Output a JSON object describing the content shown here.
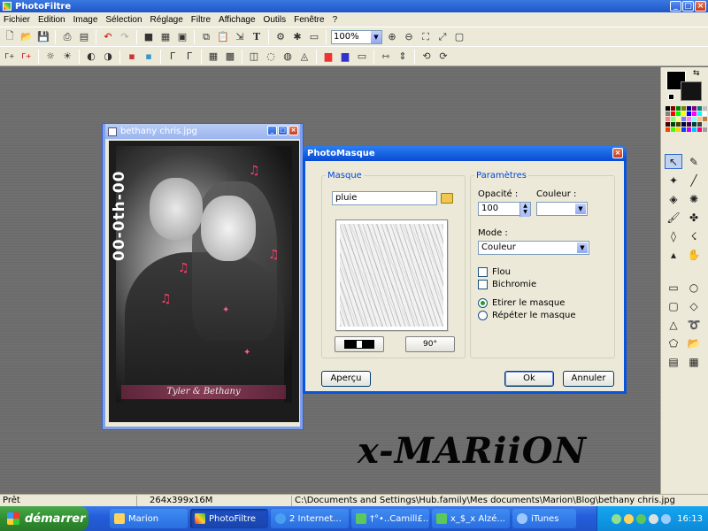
{
  "app": {
    "title": "PhotoFiltre"
  },
  "menu": [
    "Fichier",
    "Edition",
    "Image",
    "Sélection",
    "Réglage",
    "Filtre",
    "Affichage",
    "Outils",
    "Fenêtre",
    "?"
  ],
  "toolbar": {
    "zoom_value": "100%"
  },
  "image_window": {
    "title": "bethany chris.jpg",
    "vertical_text": "00-0th-00",
    "caption": "Tyler & Bethany"
  },
  "dialog": {
    "title": "PhotoMasque",
    "mask_legend": "Masque",
    "mask_name": "pluie",
    "params_legend": "Paramètres",
    "opacity_label": "Opacité :",
    "opacity_value": "100",
    "color_label": "Couleur :",
    "mode_label": "Mode :",
    "mode_value": "Couleur",
    "flou_label": "Flou",
    "bichromie_label": "Bichromie",
    "stretch_label": "Etirer le masque",
    "repeat_label": "Répéter le masque",
    "rotate_label": "90°",
    "preview_button": "Aperçu",
    "ok_button": "Ok",
    "cancel_button": "Annuler"
  },
  "signature": "x-MARiiON",
  "status": {
    "state": "Prêt",
    "dimensions": "264x399x16M",
    "path": "C:\\Documents and Settings\\Hub.family\\Mes documents\\Marion\\Blog\\bethany chris.jpg"
  },
  "taskbar": {
    "start_label": "démarrer",
    "tasks": [
      "Marion",
      "PhotoFiltre",
      "2 Internet...",
      "†°•..Camill£...",
      "x_$_x Alzé...",
      "iTunes"
    ],
    "clock": "16:13"
  },
  "colors": {
    "accent": "#0a4ad3",
    "taskbar": "#245edb",
    "start": "#2f8f2f",
    "workspace": "#6f6f6f"
  }
}
